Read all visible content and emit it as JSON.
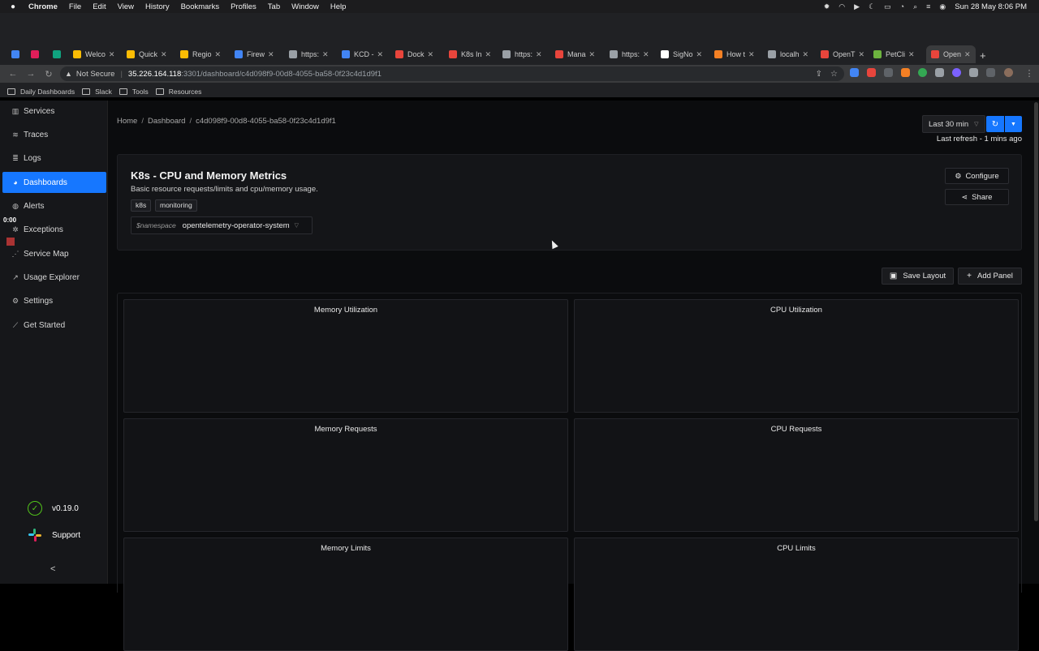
{
  "os_menubar": {
    "app_name": "Chrome",
    "menus": [
      "File",
      "Edit",
      "View",
      "History",
      "Bookmarks",
      "Profiles",
      "Tab",
      "Window",
      "Help"
    ],
    "datetime": "Sun 28 May  8:06 PM"
  },
  "browser": {
    "tabs": [
      {
        "label": "",
        "color": "#4285f4"
      },
      {
        "label": "",
        "color": "#e01e5a"
      },
      {
        "label": "",
        "color": "#10a37f"
      },
      {
        "label": "Welco",
        "color": "#fbbc04"
      },
      {
        "label": "Quick",
        "color": "#fbbc04"
      },
      {
        "label": "Regio",
        "color": "#fbbc04"
      },
      {
        "label": "Firew",
        "color": "#4285f4"
      },
      {
        "label": "https:",
        "color": "#9aa0a6"
      },
      {
        "label": "KCD -",
        "color": "#4285f4"
      },
      {
        "label": "Dock",
        "color": "#e8453c"
      },
      {
        "label": "K8s In",
        "color": "#e8453c"
      },
      {
        "label": "https:",
        "color": "#9aa0a6"
      },
      {
        "label": "Mana",
        "color": "#e8453c"
      },
      {
        "label": "https:",
        "color": "#9aa0a6"
      },
      {
        "label": "SigNo",
        "color": "#ffffff"
      },
      {
        "label": "How t",
        "color": "#f48024"
      },
      {
        "label": "localh",
        "color": "#9aa0a6"
      },
      {
        "label": "OpenT",
        "color": "#e8453c"
      },
      {
        "label": "PetCli",
        "color": "#6db33f"
      },
      {
        "label": "Open",
        "color": "#e8453c"
      }
    ],
    "security_label": "Not Secure",
    "url_host": "35.226.164.118",
    "url_path": ":3301/dashboard/c4d098f9-00d8-4055-ba58-0f23c4d1d9f1",
    "bookmarks": [
      "Daily Dashboards",
      "Slack",
      "Tools",
      "Resources"
    ]
  },
  "sidebar": {
    "items": [
      {
        "label": "Services",
        "icon": "bar-chart-icon",
        "active": false
      },
      {
        "label": "Traces",
        "icon": "traces-icon",
        "active": false
      },
      {
        "label": "Logs",
        "icon": "logs-icon",
        "active": false
      },
      {
        "label": "Dashboards",
        "icon": "dashboard-icon",
        "active": true
      },
      {
        "label": "Alerts",
        "icon": "bell-icon",
        "active": false
      },
      {
        "label": "Exceptions",
        "icon": "bug-icon",
        "active": false
      },
      {
        "label": "Service Map",
        "icon": "map-icon",
        "active": false
      },
      {
        "label": "Usage Explorer",
        "icon": "line-chart-icon",
        "active": false
      },
      {
        "label": "Settings",
        "icon": "gear-icon",
        "active": false
      },
      {
        "label": "Get Started",
        "icon": "rocket-icon",
        "active": false
      }
    ],
    "recording_time": "0:00",
    "version": "v0.19.0",
    "support_label": "Support",
    "collapse_glyph": "<"
  },
  "header": {
    "breadcrumb": [
      "Home",
      "Dashboard",
      "c4d098f9-00d8-4055-ba58-0f23c4d1d9f1"
    ],
    "time_range": "Last 30 min",
    "last_refresh": "Last refresh - 1 mins ago"
  },
  "dashboard": {
    "title": "K8s - CPU and Memory Metrics",
    "description": "Basic resource requests/limits and cpu/memory usage.",
    "tags": [
      "k8s",
      "monitoring"
    ],
    "variable_name": "$namespace",
    "variable_value": "opentelemetry-operator-system",
    "configure_label": "Configure",
    "share_label": "Share",
    "save_layout_label": "Save Layout",
    "add_panel_label": "Add Panel"
  },
  "panels": [
    {
      "title": "Memory Utilization"
    },
    {
      "title": "CPU Utilization"
    },
    {
      "title": "Memory Requests"
    },
    {
      "title": "CPU Requests"
    },
    {
      "title": "Memory Limits"
    },
    {
      "title": "CPU Limits"
    }
  ],
  "colors": {
    "accent": "#1677ff",
    "success": "#52c41a"
  }
}
